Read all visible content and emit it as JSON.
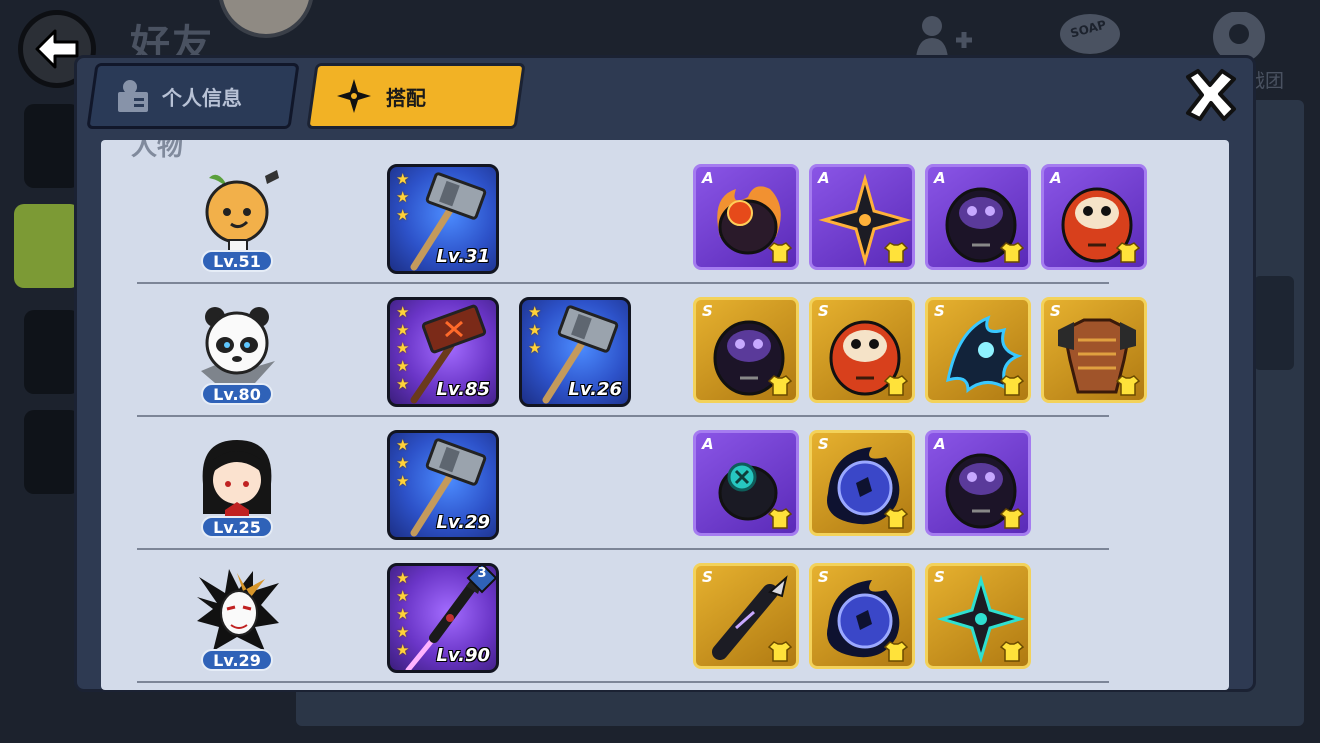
{
  "page": {
    "title": "好友",
    "side_label": "战团",
    "soap_label": "SOAP"
  },
  "tabs": [
    {
      "label": "个人信息",
      "active": false
    },
    {
      "label": "搭配",
      "active": true
    }
  ],
  "section_title": "人物",
  "colors": {
    "active_tab": "#f2b225",
    "panel": "#d3dbea",
    "rank_A": "#6a35c7",
    "rank_S": "#d39a22",
    "level_badge": "#2f62b8"
  },
  "rows": [
    {
      "character": {
        "icon": "orange-ninja-icon",
        "level": "Lv.51"
      },
      "weapons": [
        {
          "icon": "hammer-icon",
          "stars": 3,
          "level": "Lv.31",
          "bg": "blue"
        }
      ],
      "equipment": [
        {
          "rank": "A",
          "icon": "fire-ring-icon"
        },
        {
          "rank": "A",
          "icon": "shuriken-icon"
        },
        {
          "rank": "A",
          "icon": "purple-daruma-icon"
        },
        {
          "rank": "A",
          "icon": "red-daruma-icon"
        }
      ]
    },
    {
      "character": {
        "icon": "panda-ninja-icon",
        "level": "Lv.80"
      },
      "weapons": [
        {
          "icon": "red-hammer-icon",
          "stars": 5,
          "level": "Lv.85",
          "bg": "purple"
        },
        {
          "icon": "hammer-icon",
          "stars": 3,
          "level": "Lv.26",
          "bg": "blue"
        }
      ],
      "equipment": [
        {
          "rank": "S",
          "icon": "purple-daruma-icon"
        },
        {
          "rank": "S",
          "icon": "red-daruma-icon"
        },
        {
          "rank": "S",
          "icon": "spirit-wolf-icon"
        },
        {
          "rank": "S",
          "icon": "armor-icon"
        }
      ]
    },
    {
      "character": {
        "icon": "black-hair-girl-icon",
        "level": "Lv.25"
      },
      "weapons": [
        {
          "icon": "hammer-icon",
          "stars": 3,
          "level": "Lv.29",
          "bg": "blue"
        }
      ],
      "equipment": [
        {
          "rank": "A",
          "icon": "teal-ring-icon"
        },
        {
          "rank": "S",
          "icon": "dark-orb-icon"
        },
        {
          "rank": "A",
          "icon": "purple-daruma-icon"
        }
      ]
    },
    {
      "character": {
        "icon": "fox-mask-ninja-icon",
        "level": "Lv.29"
      },
      "weapons": [
        {
          "icon": "spear-icon",
          "stars": 5,
          "level": "Lv.90",
          "bg": "purple",
          "refine": "3"
        }
      ],
      "equipment": [
        {
          "rank": "S",
          "icon": "scroll-blade-icon"
        },
        {
          "rank": "S",
          "icon": "dark-orb-icon"
        },
        {
          "rank": "S",
          "icon": "teal-shuriken-icon"
        }
      ]
    }
  ]
}
